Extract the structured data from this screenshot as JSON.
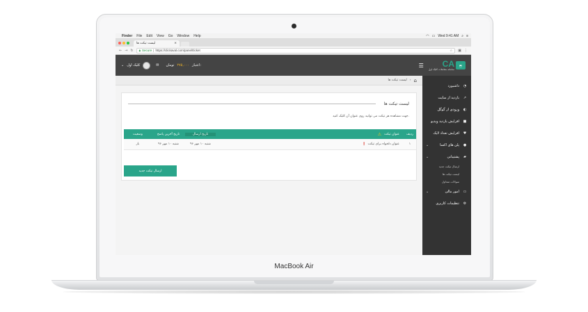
{
  "device": {
    "brand": "MacBook Air"
  },
  "mac_menu": {
    "items": [
      "Finder",
      "File",
      "Edit",
      "View",
      "Go",
      "Window",
      "Help"
    ],
    "clock": "Wed 9:41 AM"
  },
  "browser": {
    "tab_title": "لیست تیکت ها",
    "tab_close": "×",
    "secure_label": "Secure",
    "url": "https://clickaval.com/panel/ticket"
  },
  "header": {
    "user_name": "کلیک اول",
    "balance_label": "اعتبار:",
    "balance_amount": "۲۷۵,۰۰۰",
    "balance_unit": "تومان",
    "logo_text": "CA",
    "logo_subtitle": "سامانه معاملات کلیک اول"
  },
  "breadcrumb": {
    "current": "لیست تیکت ها"
  },
  "sidebar": {
    "items": [
      {
        "label": "داشبورد",
        "icon": "dashboard-icon"
      },
      {
        "label": "بازدید از سایت",
        "icon": "chart-icon"
      },
      {
        "label": "ورودی از گوگل",
        "icon": "google-icon"
      },
      {
        "label": "افزایش بازدید ویدیو",
        "icon": "video-icon"
      },
      {
        "label": "افزایش تعداد لایک",
        "icon": "heart-icon"
      },
      {
        "label": "پلن های اکسا",
        "icon": "user-icon"
      },
      {
        "label": "پشتیبانی",
        "icon": "chat-icon"
      }
    ],
    "support_sub": [
      "ارسال تیکت جدید",
      "لیست تیکت ها",
      "سوالات متداول"
    ],
    "bottom_items": [
      {
        "label": "امور مالی",
        "icon": "card-icon"
      },
      {
        "label": "تنظیمات کاربری",
        "icon": "settings-icon"
      }
    ]
  },
  "card": {
    "title": "لیست تیکت ها",
    "description": "جهت مشاهده هر تیکت می توانید روی عنوان آن کلیک کنید."
  },
  "table": {
    "headers": {
      "idx": "ردیف",
      "title": "عنوان تیکت",
      "send_date": "تاریخ ارسال",
      "last_reply": "تاریخ آخرین پاسخ",
      "status": "وضعیت"
    },
    "rows": [
      {
        "idx": "۱",
        "title": "عنوان دلخواه برای تیکت",
        "send_date": "شنبه ۱۰ مهر ۹۶",
        "last_reply": "شنبه ۱۰ مهر ۹۶",
        "status": "باز"
      }
    ]
  },
  "actions": {
    "new_ticket": "ارسال تیکت جدید"
  },
  "colors": {
    "accent": "#2aa58a",
    "header": "#444444",
    "sidebar": "#333333",
    "balance": "#f0b429"
  }
}
